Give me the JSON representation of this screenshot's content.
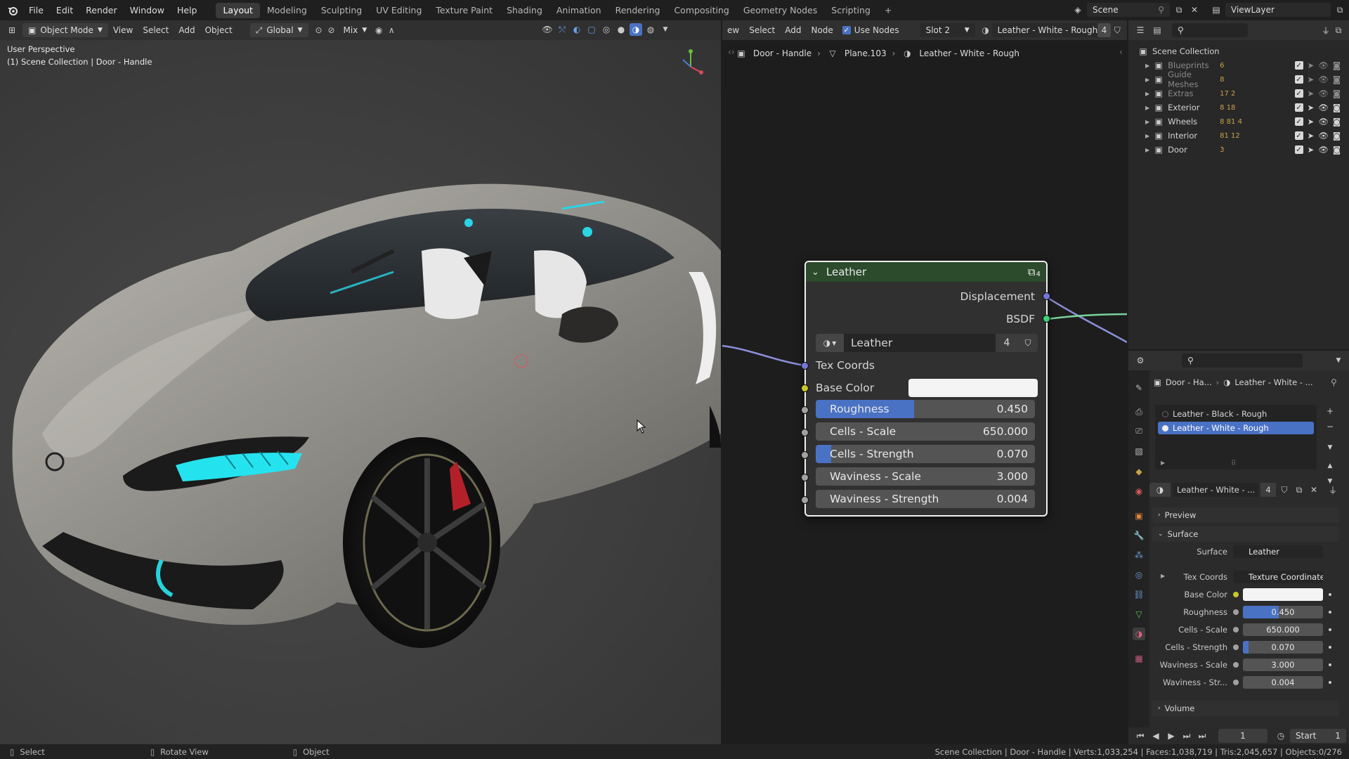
{
  "app": {
    "menu": [
      "File",
      "Edit",
      "Render",
      "Window",
      "Help"
    ],
    "workspaces": [
      "Layout",
      "Modeling",
      "Sculpting",
      "UV Editing",
      "Texture Paint",
      "Shading",
      "Animation",
      "Rendering",
      "Compositing",
      "Geometry Nodes",
      "Scripting"
    ],
    "active_workspace": "Layout",
    "add_workspace": "+",
    "scene": "Scene",
    "view_layer": "ViewLayer"
  },
  "viewport_header": {
    "mode": "Object Mode",
    "menus": [
      "View",
      "Select",
      "Add",
      "Object"
    ],
    "transform_orientation": "Global",
    "snap_mode": "Mix"
  },
  "viewport": {
    "perspective": "User Perspective",
    "context": "(1) Scene Collection | Door - Handle"
  },
  "node_header": {
    "menus": [
      "ew",
      "Select",
      "Add",
      "Node"
    ],
    "use_nodes_label": "Use Nodes",
    "slot": "Slot 2",
    "material": "Leather - White - Rough",
    "users": "4"
  },
  "breadcrumb": [
    "Door - Handle",
    "Plane.103",
    "Leather - White - Rough"
  ],
  "node": {
    "title": "Leather",
    "users_badge": "4",
    "outputs": [
      "Displacement",
      "BSDF"
    ],
    "group_name": "Leather",
    "group_users": "4",
    "tex_coords": "Tex Coords",
    "base_color_label": "Base Color",
    "base_color": "#f4f4f4",
    "fields": [
      {
        "label": "Roughness",
        "value": "0.450",
        "fraction": 0.45
      },
      {
        "label": "Cells - Scale",
        "value": "650.000",
        "fraction": 0
      },
      {
        "label": "Cells - Strength",
        "value": "0.070",
        "fraction": 0.07
      },
      {
        "label": "Waviness - Scale",
        "value": "3.000",
        "fraction": 0
      },
      {
        "label": "Waviness - Strength",
        "value": "0.004",
        "fraction": 0
      }
    ]
  },
  "outliner": {
    "root": "Scene Collection",
    "items": [
      {
        "name": "Blueprints",
        "badge": "6",
        "dim": true
      },
      {
        "name": "Guide Meshes",
        "badge": "8",
        "dim": true
      },
      {
        "name": "Extras",
        "badge": "17 2",
        "dim": true
      },
      {
        "name": "Exterior",
        "badge": "8 18",
        "dim": false
      },
      {
        "name": "Wheels",
        "badge": "8 81 4",
        "dim": false
      },
      {
        "name": "Interior",
        "badge": "81 12",
        "dim": false
      },
      {
        "name": "Door",
        "badge": "3",
        "dim": false
      }
    ]
  },
  "properties": {
    "breadcrumb_object": "Door - Ha...",
    "breadcrumb_material": "Leather - White - ...",
    "material_slots": [
      "Leather - Black - Rough",
      "Leather - White - Rough"
    ],
    "active_slot": 1,
    "material_name": "Leather - White - ...",
    "material_users": "4",
    "preview_label": "Preview",
    "surface_label": "Surface",
    "surface_field_label": "Surface",
    "surface_value": "Leather",
    "tex_coords_label": "Tex Coords",
    "tex_coords_value": "Texture Coordinate ...",
    "base_color_label": "Base Color",
    "base_color": "#f4f4f4",
    "rows": [
      {
        "label": "Roughness",
        "value": "0.450",
        "fraction": 0.45
      },
      {
        "label": "Cells - Scale",
        "value": "650.000",
        "fraction": 0
      },
      {
        "label": "Cells - Strength",
        "value": "0.070",
        "fraction": 0.07
      },
      {
        "label": "Waviness - Scale",
        "value": "3.000",
        "fraction": 0
      },
      {
        "label": "Waviness - Str...",
        "value": "0.004",
        "fraction": 0
      }
    ],
    "volume_label": "Volume"
  },
  "timeline": {
    "frame": "1",
    "start": "Start",
    "start_value": "1"
  },
  "statusbar": {
    "left": [
      "Select",
      "Rotate View",
      "Object"
    ],
    "right": "Scene Collection | Door - Handle | Verts:1,033,254 | Faces:1,038,719 | Tris:2,045,657 | Objects:0/276"
  }
}
